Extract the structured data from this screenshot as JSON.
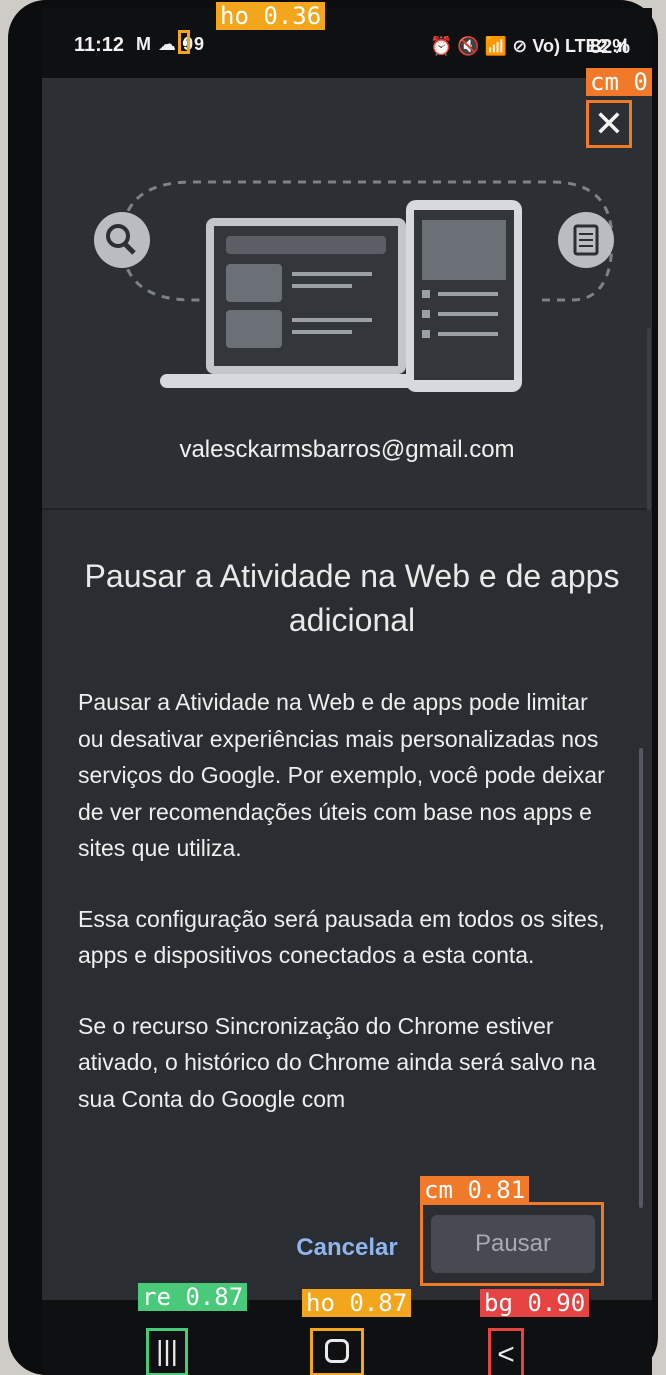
{
  "status_bar": {
    "time": "11:12",
    "notifications": "M ☁ 99",
    "system_icons": "⏰ 🔇 📶 ⊘ Vo) LTE2 .ıl",
    "battery": "82%"
  },
  "overlays": {
    "dot_label": "ho 0.36",
    "close_label": "cm 0",
    "pause_label": "cm 0.81",
    "recent_label": "re 0.87",
    "home_label": "ho 0.87",
    "back_label": "bg 0.90"
  },
  "account": {
    "email": "valesckarmsbarros@gmail.com"
  },
  "dialog": {
    "title": "Pausar a Atividade na Web e de apps adicional",
    "paragraphs": [
      "Pausar a Atividade na Web e de apps pode limitar ou desativar experiências mais personalizadas nos serviços do Google. Por exemplo, você pode deixar de ver recomendações úteis com base nos apps e sites que utiliza.",
      "Essa configuração será pausada em todos os sites, apps e dispositivos conectados a esta conta.",
      "Se o recurso Sincronização do Chrome estiver ativado, o histórico do Chrome ainda será salvo na sua Conta do Google com"
    ],
    "cancel_label": "Cancelar",
    "pause_label": "Pausar"
  },
  "icons": {
    "close": "close-icon",
    "search": "search-icon",
    "document": "document-icon",
    "recent": "recent-apps-icon",
    "home": "home-icon",
    "back": "back-icon"
  },
  "colors": {
    "accent_link": "#8fb5ee",
    "dialog_bg": "#2a2d31",
    "disabled_button": "#474b51"
  }
}
